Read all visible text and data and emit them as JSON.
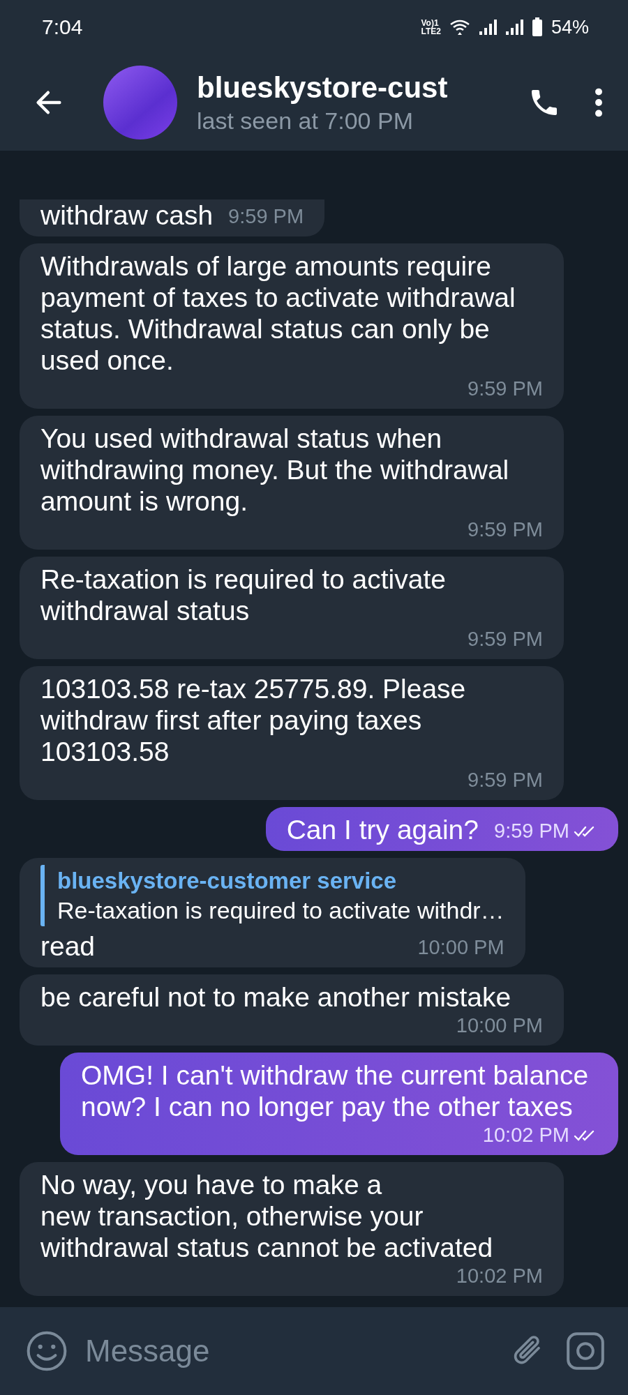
{
  "status_bar": {
    "time": "7:04",
    "volte_top": "Vo)1",
    "volte_bottom": "LTE2",
    "battery": "54%"
  },
  "header": {
    "title": "blueskystore-cust",
    "subtitle": "last seen at 7:00 PM"
  },
  "messages": [
    {
      "kind": "in",
      "text": "withdraw cash",
      "time": "9:59 PM"
    },
    {
      "kind": "in",
      "text": "Withdrawals of large amounts require payment of taxes to activate withdrawal status. Withdrawal status can only be used once.",
      "time": "9:59 PM"
    },
    {
      "kind": "in",
      "text": "You used withdrawal status when withdrawing money. But the withdrawal amount is wrong.",
      "time": "9:59 PM"
    },
    {
      "kind": "in",
      "text": "Re-taxation is required to activate withdrawal status",
      "time": "9:59 PM"
    },
    {
      "kind": "in",
      "text": "103103.58 re-tax 25775.89. Please withdraw first after paying taxes 103103.58",
      "time": "9:59 PM"
    },
    {
      "kind": "out",
      "text": "Can I try again?",
      "time": "9:59 PM",
      "read": true
    },
    {
      "kind": "reply",
      "reply_name": "blueskystore-customer service",
      "reply_text": "Re-taxation is required to activate withdr…",
      "text": "read",
      "time": "10:00 PM"
    },
    {
      "kind": "in",
      "text": "be careful not to make another mistake",
      "time": "10:00 PM"
    },
    {
      "kind": "out",
      "text": "OMG! I can't withdraw the current balance now? I can no longer pay the other taxes",
      "time": "10:02 PM",
      "read": true
    },
    {
      "kind": "in",
      "text": "No way, you have to make a\nnew transaction, otherwise your withdrawal status cannot be activated",
      "time": "10:02 PM"
    }
  ],
  "composer": {
    "placeholder": "Message"
  }
}
